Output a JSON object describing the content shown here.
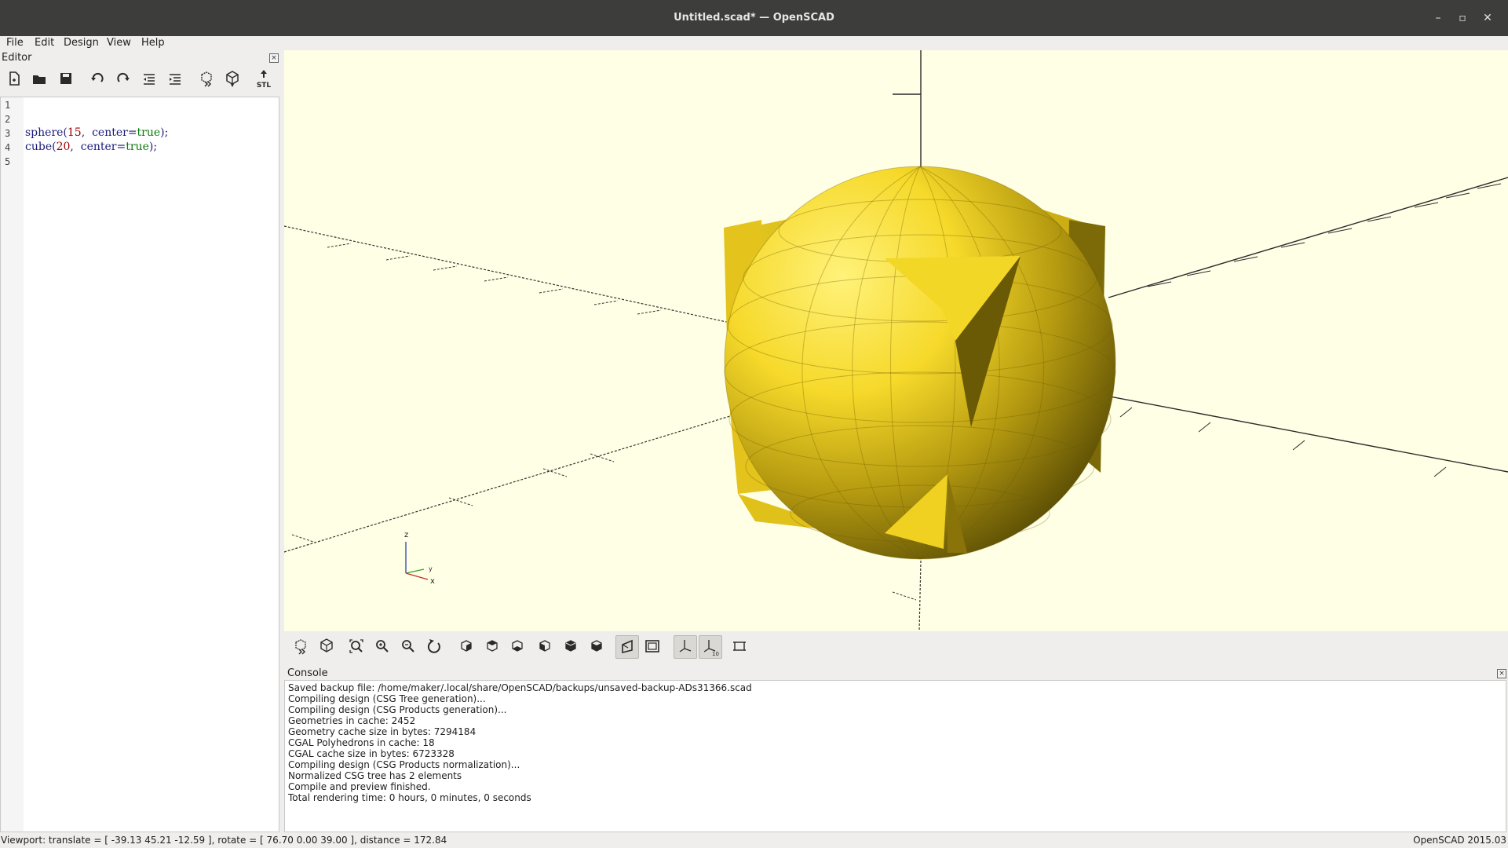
{
  "window": {
    "title": "Untitled.scad* — OpenSCAD",
    "minimize_glyph": "–",
    "maximize_glyph": "▫",
    "close_glyph": "✕"
  },
  "menu": [
    "File",
    "Edit",
    "Design",
    "View",
    "Help"
  ],
  "editor": {
    "label": "Editor",
    "toolbar_icons": [
      "new-file-icon",
      "open-file-icon",
      "save-icon",
      "undo-icon",
      "redo-icon",
      "unindent-icon",
      "indent-icon",
      "preview-icon",
      "render-icon",
      "export-stl-icon"
    ],
    "stl_label": "STL",
    "line_numbers": [
      "1",
      "2",
      "3",
      "4",
      "5"
    ],
    "lines": [
      {
        "a": "",
        "n": "",
        "b": "",
        "k": "",
        "c": ""
      },
      {
        "a": "",
        "n": "",
        "b": "",
        "k": "",
        "c": ""
      },
      {
        "a": "sphere(",
        "n": "15",
        "b": ",  center=",
        "k": "true",
        "c": ");"
      },
      {
        "a": "cube(",
        "n": "20",
        "b": ",  center=",
        "k": "true",
        "c": ");"
      },
      {
        "a": "",
        "n": "",
        "b": "",
        "k": "",
        "c": ""
      }
    ]
  },
  "viewport": {
    "background": "#ffffe5",
    "model_color": "#f8e23a",
    "axis_labels": {
      "z": "z",
      "y": "y",
      "x": "x"
    }
  },
  "view_toolbar": {
    "icons": [
      "preview-icon",
      "render-icon",
      "zoom-all-icon",
      "zoom-in-icon",
      "zoom-out-icon",
      "reset-view-icon",
      "view-right-icon",
      "view-top-icon",
      "view-bottom-icon",
      "view-left-icon",
      "view-front-icon",
      "view-back-icon",
      "perspective-icon",
      "orthogonal-icon",
      "show-axes-icon",
      "show-scale-markers-icon",
      "show-edges-icon"
    ],
    "scale_label": "10"
  },
  "console": {
    "label": "Console",
    "lines": [
      "Saved backup file: /home/maker/.local/share/OpenSCAD/backups/unsaved-backup-ADs31366.scad",
      "Compiling design (CSG Tree generation)...",
      "Compiling design (CSG Products generation)...",
      "Geometries in cache: 2452",
      "Geometry cache size in bytes: 7294184",
      "CGAL Polyhedrons in cache: 18",
      "CGAL cache size in bytes: 6723328",
      "Compiling design (CSG Products normalization)...",
      "Normalized CSG tree has 2 elements",
      "Compile and preview finished.",
      "Total rendering time: 0 hours, 0 minutes, 0 seconds"
    ]
  },
  "status": {
    "viewport_info": "Viewport: translate = [ -39.13 45.21 -12.59 ], rotate = [ 76.70 0.00 39.00 ], distance = 172.84",
    "version": "OpenSCAD 2015.03"
  }
}
